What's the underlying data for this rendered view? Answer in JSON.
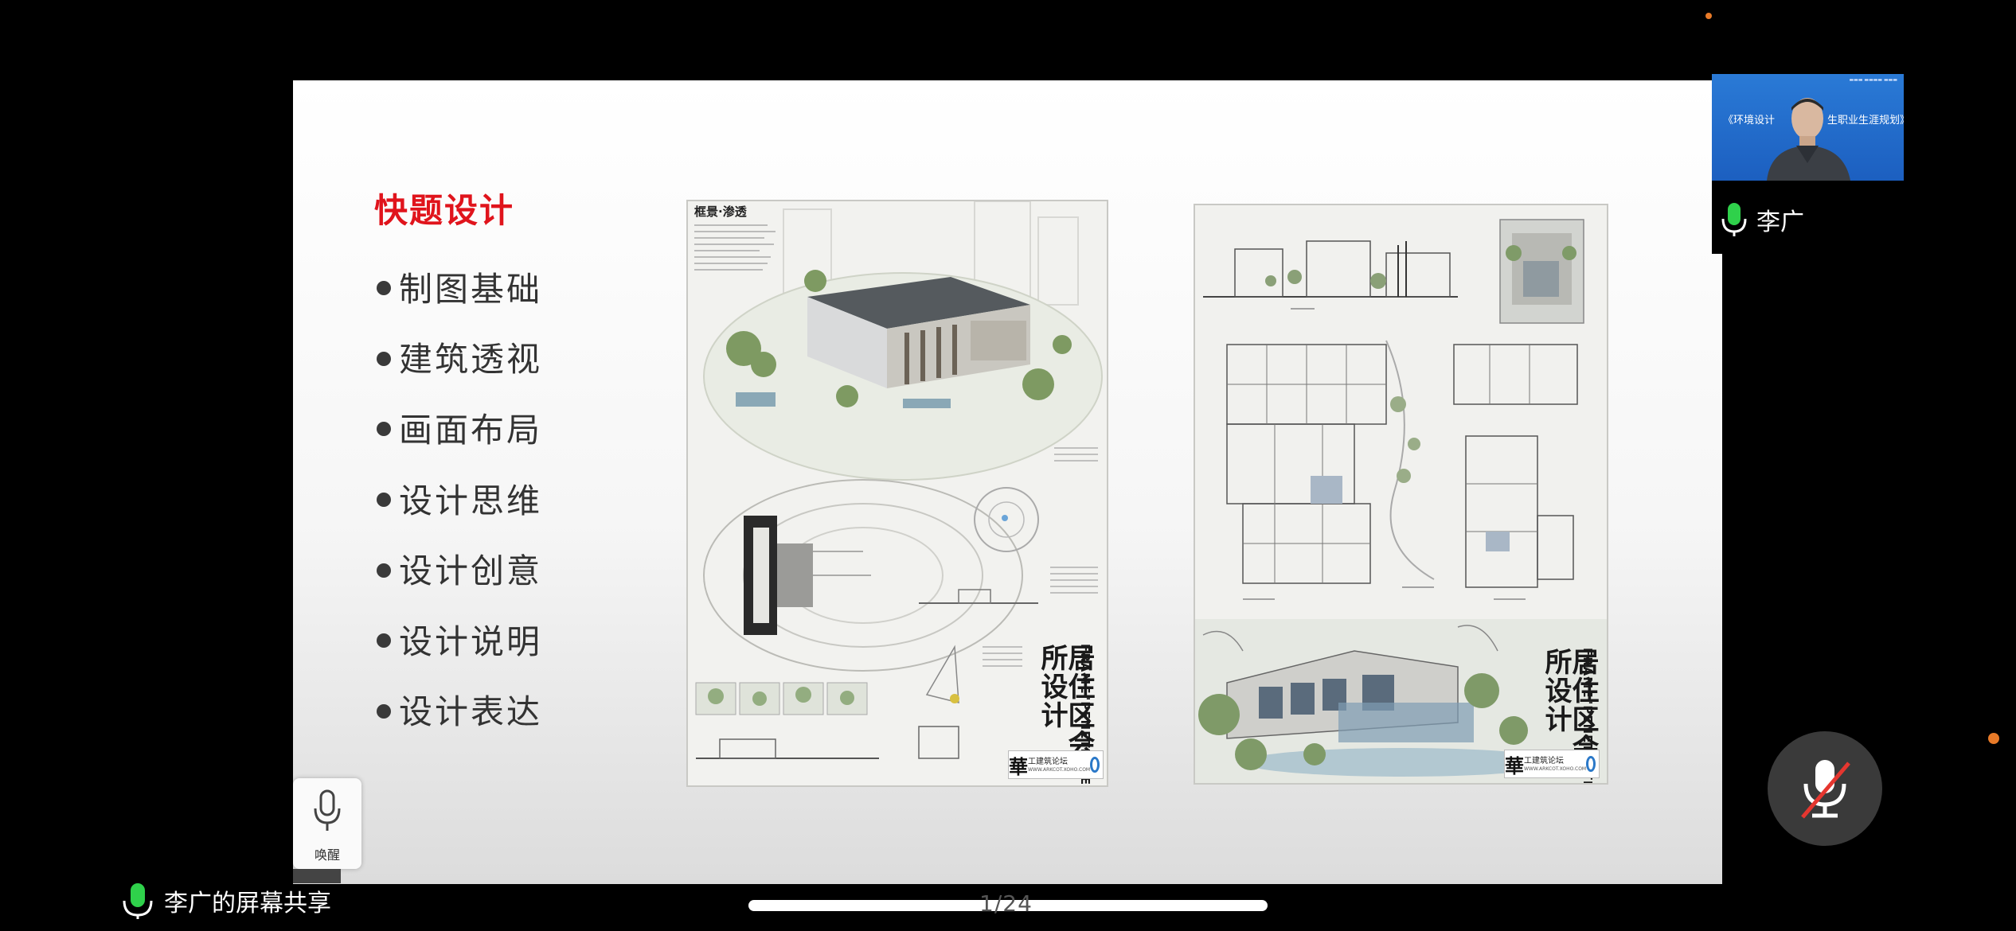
{
  "slide": {
    "title": "快题设计",
    "bullets": [
      "制图基础",
      "建筑透视",
      "画面布局",
      "设计思维",
      "设计创意",
      "设计说明",
      "设计表达"
    ],
    "title_color": "#e0141c"
  },
  "posters": {
    "left": {
      "heading": "框景·渗透",
      "vertical_title": "居住区会所设计",
      "vertical_subtitle": "FRAME\"PENETRATE",
      "logo_char": "華",
      "logo_text": "工建筑论坛",
      "logo_url": "WWW.ARKCOT.XOHO.COM"
    },
    "right": {
      "vertical_title": "居住区会所设计",
      "vertical_subtitle": "FRAME\"PENETRATE",
      "logo_char": "華",
      "logo_text": "工建筑论坛",
      "logo_url": "WWW.ARKCOT.XOHO.COM"
    }
  },
  "voice_widget": {
    "label": "唤醒",
    "icon": "microphone-icon"
  },
  "participant": {
    "name": "李广",
    "video_caption_left": "《环境设计",
    "video_caption_right": "生职业生涯规划》",
    "mic_icon": "microphone-active-icon"
  },
  "share": {
    "label": "李广的屏幕共享",
    "icon": "microphone-active-icon"
  },
  "mute_button": {
    "icon": "microphone-muted-icon"
  },
  "page_indicator": "1/24",
  "colors": {
    "accent_green": "#2fd14b",
    "status_orange": "#e87a28",
    "mute_slash": "#e5362f"
  }
}
